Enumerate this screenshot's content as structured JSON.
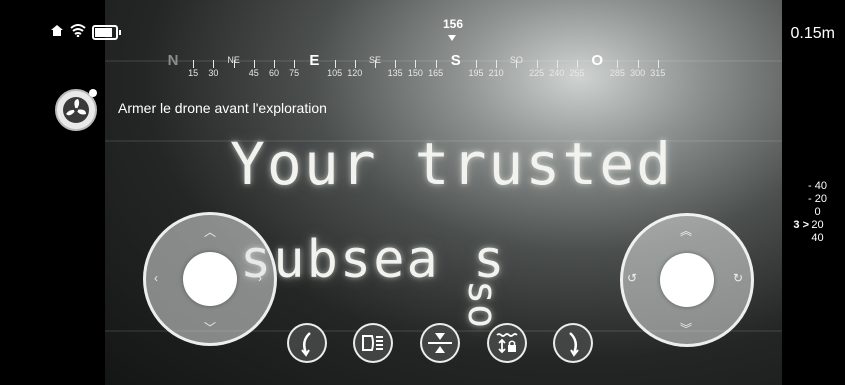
{
  "status": {
    "depth": "0.15m",
    "battery_level": 0.85
  },
  "compass": {
    "heading": "156",
    "labels": [
      {
        "text": "N",
        "type": "card"
      },
      {
        "text": "15",
        "type": "num"
      },
      {
        "text": "30",
        "type": "num"
      },
      {
        "text": "NE",
        "type": "mid"
      },
      {
        "text": "45",
        "type": "num"
      },
      {
        "text": "60",
        "type": "num"
      },
      {
        "text": "75",
        "type": "num"
      },
      {
        "text": "E",
        "type": "card"
      },
      {
        "text": "105",
        "type": "num"
      },
      {
        "text": "120",
        "type": "num"
      },
      {
        "text": "SE",
        "type": "mid"
      },
      {
        "text": "135",
        "type": "num"
      },
      {
        "text": "150",
        "type": "num"
      },
      {
        "text": "165",
        "type": "num"
      },
      {
        "text": "S",
        "type": "card"
      },
      {
        "text": "195",
        "type": "num"
      },
      {
        "text": "210",
        "type": "num"
      },
      {
        "text": "SO",
        "type": "mid"
      },
      {
        "text": "225",
        "type": "num"
      },
      {
        "text": "240",
        "type": "num"
      },
      {
        "text": "255",
        "type": "num"
      },
      {
        "text": "O",
        "type": "card"
      },
      {
        "text": "285",
        "type": "num"
      },
      {
        "text": "300",
        "type": "num"
      },
      {
        "text": "315",
        "type": "num"
      }
    ]
  },
  "arm": {
    "message": "Armer le drone avant l'exploration",
    "icon": "fan-icon"
  },
  "feed": {
    "line1": "Your trusted",
    "line2": "subsea s",
    "line3": "so"
  },
  "gauge": {
    "values": [
      "- 40",
      "- 20",
      "0",
      "20",
      "40"
    ],
    "current": "3 >"
  },
  "bottom_buttons": [
    {
      "name": "roll-left-button",
      "icon": "roll-left-icon"
    },
    {
      "name": "lights-button",
      "icon": "headlight-icon"
    },
    {
      "name": "depth-hold-button",
      "icon": "depth-hold-icon"
    },
    {
      "name": "water-lock-button",
      "icon": "water-lock-icon"
    },
    {
      "name": "roll-right-button",
      "icon": "roll-right-icon"
    }
  ]
}
